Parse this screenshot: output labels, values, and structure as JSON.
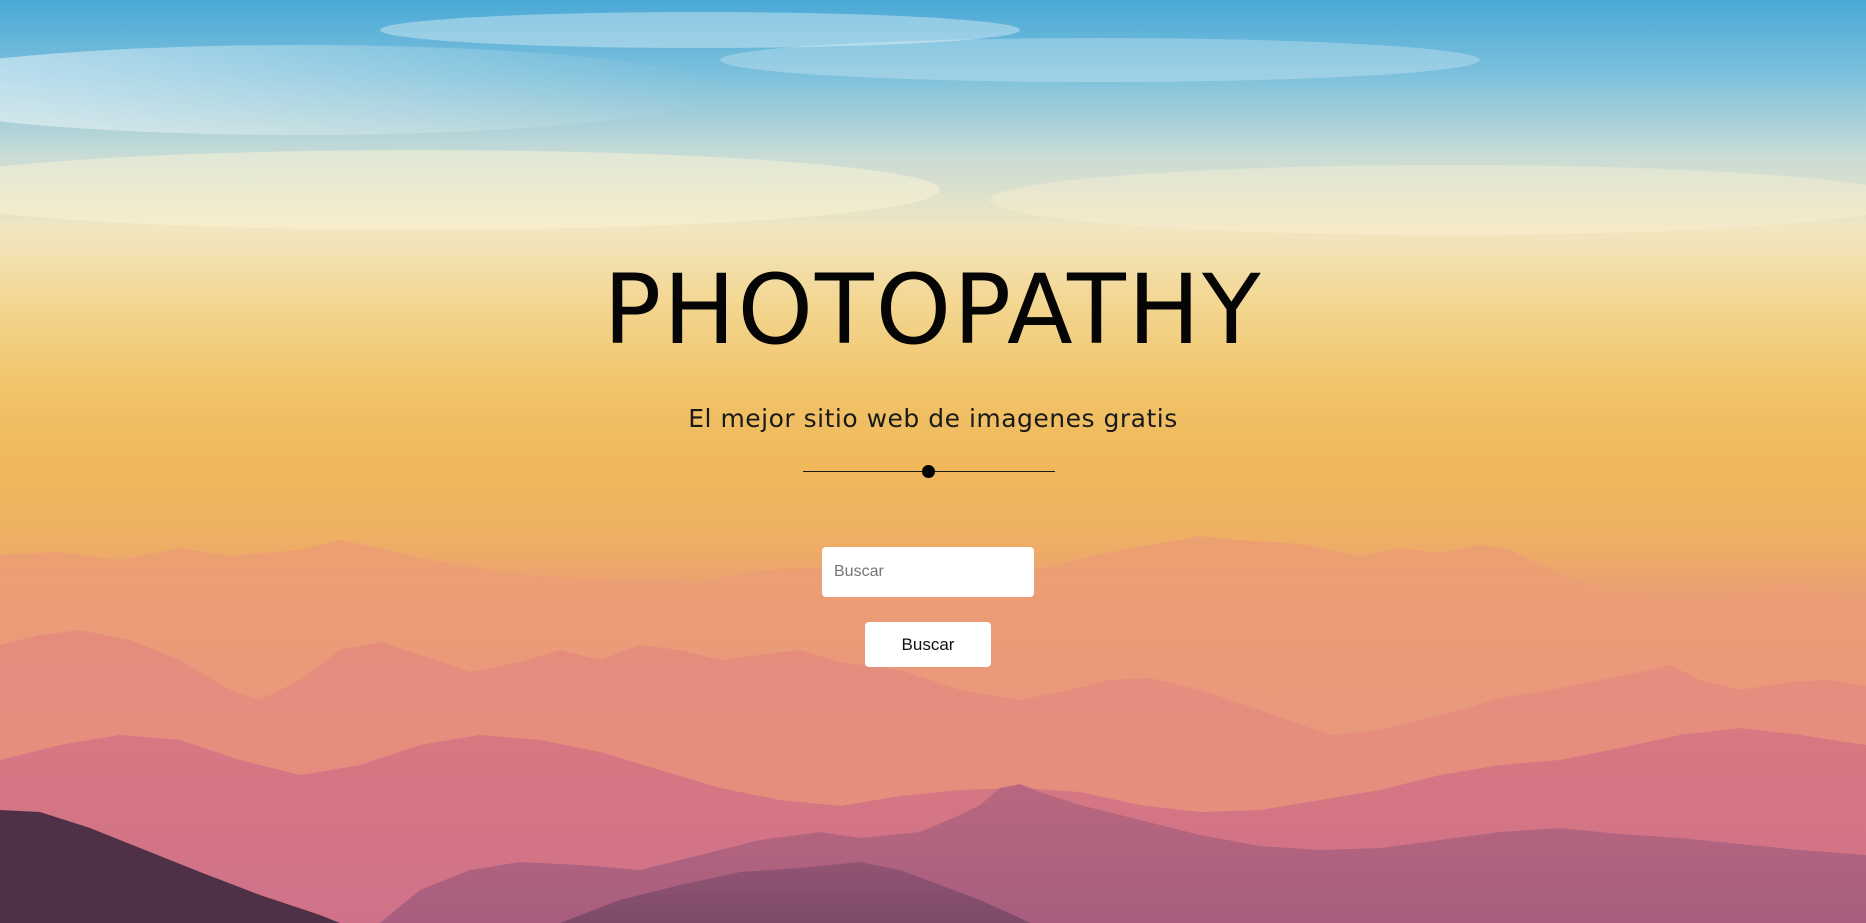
{
  "hero": {
    "title": "PHOTOPATHY",
    "subtitle": "El mejor sitio web de imagenes gratis"
  },
  "search": {
    "placeholder": "Buscar",
    "value": "",
    "button_label": "Buscar"
  }
}
